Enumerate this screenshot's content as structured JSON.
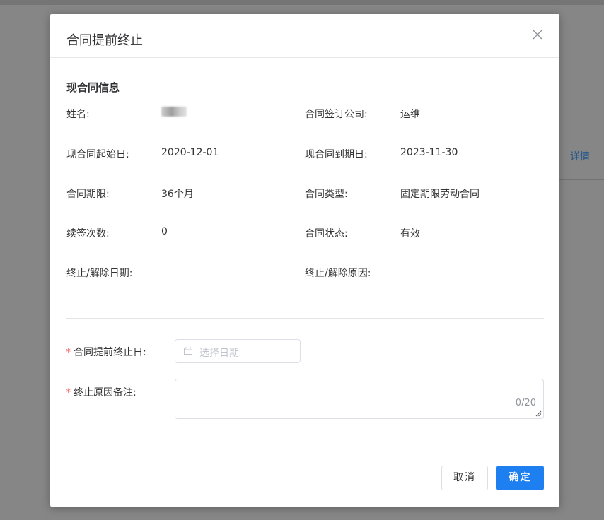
{
  "background": {
    "detail_link": "详情"
  },
  "dialog": {
    "title": "合同提前终止",
    "close_icon": "close-icon",
    "section_title": "现合同信息",
    "info": {
      "name_label": "姓名:",
      "company_label": "合同签订公司:",
      "company_value": "运维",
      "start_label": "现合同起始日:",
      "start_value": "2020-12-01",
      "end_label": "现合同到期日:",
      "end_value": "2023-11-30",
      "term_label": "合同期限:",
      "term_value": "36个月",
      "type_label": "合同类型:",
      "type_value": "固定期限劳动合同",
      "renew_label": "续签次数:",
      "renew_value": "0",
      "status_label": "合同状态:",
      "status_value": "有效",
      "terminate_date_label": "终止/解除日期:",
      "terminate_reason_label": "终止/解除原因:"
    },
    "form": {
      "required_mark": "*",
      "early_end_label": "合同提前终止日:",
      "date_placeholder": "选择日期",
      "reason_label": "终止原因备注:",
      "reason_counter": "0/20"
    },
    "buttons": {
      "cancel": "取消",
      "ok": "确定"
    },
    "colors": {
      "primary": "#1e7ff0",
      "required": "#f56c6c",
      "link": "#409eff"
    }
  }
}
